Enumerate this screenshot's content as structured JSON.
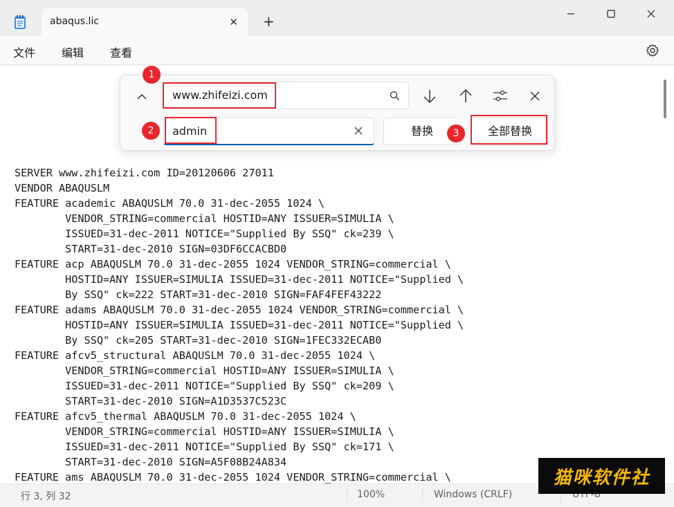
{
  "window": {
    "tab_title": "abaqus.lic",
    "new_tab_symbol": "+",
    "controls": [
      "minimize-icon",
      "maximize-icon",
      "close-icon"
    ]
  },
  "menu": {
    "file": "文件",
    "edit": "编辑",
    "view": "查看",
    "settings_icon": "gear-icon"
  },
  "find_panel": {
    "find_value": "www.zhifeizi.com",
    "replace_value": "admin",
    "replace_label": "替换",
    "replace_all_label": "全部替换",
    "icons": [
      "chevron-up-icon",
      "search-icon",
      "clear-icon",
      "arrow-down-icon",
      "arrow-up-icon",
      "options-icon",
      "close-icon"
    ]
  },
  "annotations": {
    "marker_1": "1",
    "marker_2": "2",
    "marker_3": "3",
    "highlight_color": "#e8262c"
  },
  "editor": {
    "lines": [
      "SERVER www.zhifeizi.com ID=20120606 27011",
      "VENDOR ABAQUSLM",
      "FEATURE academic ABAQUSLM 70.0 31-dec-2055 1024 \\",
      "        VENDOR_STRING=commercial HOSTID=ANY ISSUER=SIMULIA \\",
      "        ISSUED=31-dec-2011 NOTICE=\"Supplied By SSQ\" ck=239 \\",
      "        START=31-dec-2010 SIGN=03DF6CCACBD0",
      "FEATURE acp ABAQUSLM 70.0 31-dec-2055 1024 VENDOR_STRING=commercial \\",
      "        HOSTID=ANY ISSUER=SIMULIA ISSUED=31-dec-2011 NOTICE=\"Supplied \\",
      "        By SSQ\" ck=222 START=31-dec-2010 SIGN=FAF4FEF43222",
      "FEATURE adams ABAQUSLM 70.0 31-dec-2055 1024 VENDOR_STRING=commercial \\",
      "        HOSTID=ANY ISSUER=SIMULIA ISSUED=31-dec-2011 NOTICE=\"Supplied \\",
      "        By SSQ\" ck=205 START=31-dec-2010 SIGN=1FEC332ECAB0",
      "FEATURE afcv5_structural ABAQUSLM 70.0 31-dec-2055 1024 \\",
      "        VENDOR_STRING=commercial HOSTID=ANY ISSUER=SIMULIA \\",
      "        ISSUED=31-dec-2011 NOTICE=\"Supplied By SSQ\" ck=209 \\",
      "        START=31-dec-2010 SIGN=A1D3537C523C",
      "FEATURE afcv5_thermal ABAQUSLM 70.0 31-dec-2055 1024 \\",
      "        VENDOR_STRING=commercial HOSTID=ANY ISSUER=SIMULIA \\",
      "        ISSUED=31-dec-2011 NOTICE=\"Supplied By SSQ\" ck=171 \\",
      "        START=31-dec-2010 SIGN=A5F08B24A834",
      "FEATURE ams ABAQUSLM 70.0 31-dec-2055 1024 VENDOR_STRING=commercial \\"
    ]
  },
  "status": {
    "position": "行 3, 列 32",
    "zoom": "100%",
    "line_ending": "Windows (CRLF)",
    "encoding": "UTF-8"
  },
  "watermark": {
    "text": "猫咪软件社"
  }
}
